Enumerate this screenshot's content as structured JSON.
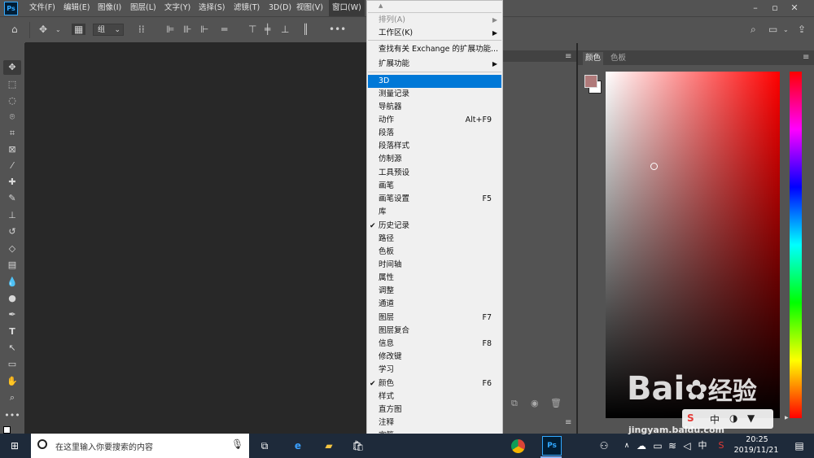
{
  "menubar": {
    "logo": "Ps",
    "items": [
      "文件(F)",
      "编辑(E)",
      "图像(I)",
      "图层(L)",
      "文字(Y)",
      "选择(S)",
      "滤镜(T)",
      "3D(D)",
      "视图(V)",
      "窗口(W)"
    ],
    "window_controls": [
      "–",
      "▫",
      "✕"
    ]
  },
  "options": {
    "group_label": "组"
  },
  "right_panel": {
    "tabs": [
      "颜色",
      "色板"
    ]
  },
  "window_menu": {
    "items": [
      {
        "label": "排列(A)",
        "submenu": true,
        "disabled": true
      },
      {
        "label": "工作区(K)",
        "submenu": true
      },
      {
        "label": "查找有关 Exchange 的扩展功能..."
      },
      {
        "label": "扩展功能",
        "submenu": true
      },
      {
        "label": "3D",
        "highlighted": true
      },
      {
        "label": "测量记录"
      },
      {
        "label": "导航器"
      },
      {
        "label": "动作",
        "shortcut": "Alt+F9"
      },
      {
        "label": "段落"
      },
      {
        "label": "段落样式"
      },
      {
        "label": "仿制源"
      },
      {
        "label": "工具预设"
      },
      {
        "label": "画笔"
      },
      {
        "label": "画笔设置",
        "shortcut": "F5"
      },
      {
        "label": "库"
      },
      {
        "label": "历史记录",
        "checked": true
      },
      {
        "label": "路径"
      },
      {
        "label": "色板"
      },
      {
        "label": "时间轴"
      },
      {
        "label": "属性"
      },
      {
        "label": "调整"
      },
      {
        "label": "通道"
      },
      {
        "label": "图层",
        "shortcut": "F7"
      },
      {
        "label": "图层复合"
      },
      {
        "label": "信息",
        "shortcut": "F8"
      },
      {
        "label": "修改键"
      },
      {
        "label": "学习"
      },
      {
        "label": "颜色",
        "shortcut": "F6",
        "checked": true
      },
      {
        "label": "样式"
      },
      {
        "label": "直方图"
      },
      {
        "label": "注释"
      },
      {
        "label": "字符"
      }
    ]
  },
  "taskbar": {
    "search_placeholder": "在这里输入你要搜索的内容",
    "clock_time": "20:25",
    "clock_date": "2019/11/21",
    "ime": "中"
  },
  "watermark": {
    "brand": "Bai",
    "brand2": "经验",
    "url": "jingyam.baidu.com"
  },
  "colors": {
    "ui_dark": "#535353",
    "canvas": "#282828",
    "highlight": "#0078d7",
    "fg_swatch": "#b07a7a"
  }
}
